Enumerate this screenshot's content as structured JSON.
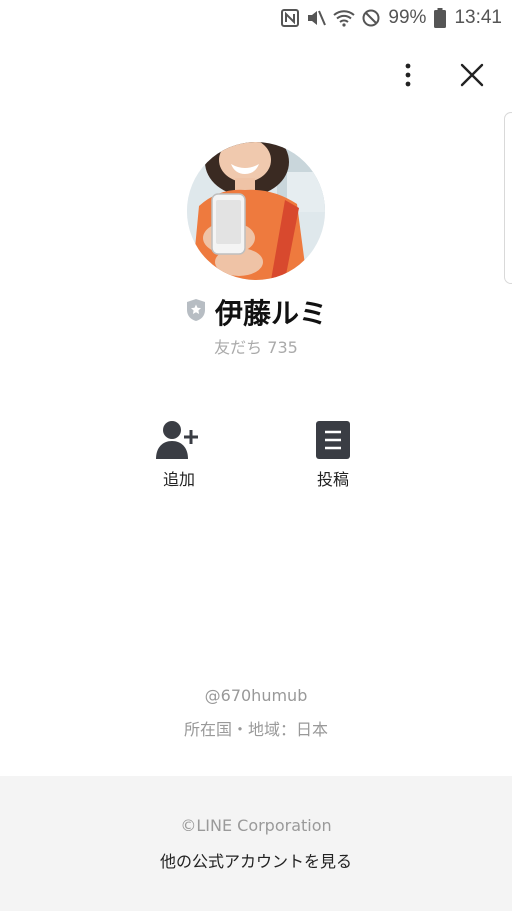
{
  "status_bar": {
    "battery": "99%",
    "time": "13:41",
    "icons": [
      "nfc-icon",
      "mute-icon",
      "wifi-icon",
      "do-not-disturb-icon",
      "battery-icon"
    ]
  },
  "top_actions": {
    "icons": [
      "more-vertical-icon",
      "close-icon"
    ]
  },
  "profile": {
    "name": "伊藤ルミ",
    "friends": "友だち 735",
    "badge_icon": "verified-shield-icon"
  },
  "actions": [
    {
      "label": "追加",
      "icon": "add-friend-icon"
    },
    {
      "label": "投稿",
      "icon": "post-icon"
    }
  ],
  "info": {
    "handle": "@670humub",
    "region": "所在国・地域：日本"
  },
  "footer": {
    "copyright": "©LINE Corporation",
    "more_accounts": "他の公式アカウントを見る"
  }
}
